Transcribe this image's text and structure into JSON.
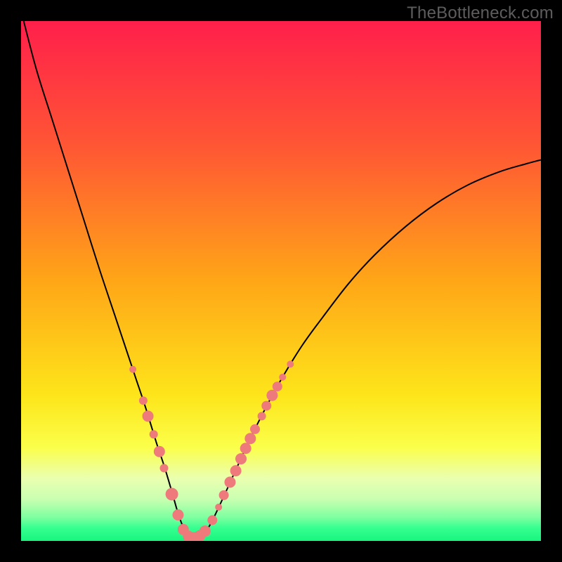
{
  "watermark": "TheBottleneck.com",
  "chart_data": {
    "type": "line",
    "title": "",
    "xlabel": "",
    "ylabel": "",
    "xlim": [
      0,
      100
    ],
    "ylim": [
      0,
      100
    ],
    "grid": false,
    "legend": false,
    "axes_visible": false,
    "background": {
      "type": "vertical-gradient",
      "stops": [
        {
          "pos": 0.0,
          "color": "#ff1f4b"
        },
        {
          "pos": 0.24,
          "color": "#ff5634"
        },
        {
          "pos": 0.5,
          "color": "#ffa617"
        },
        {
          "pos": 0.72,
          "color": "#fde51a"
        },
        {
          "pos": 0.82,
          "color": "#fbff4a"
        },
        {
          "pos": 0.88,
          "color": "#eaffb0"
        },
        {
          "pos": 0.92,
          "color": "#c9ffb1"
        },
        {
          "pos": 0.955,
          "color": "#7dffa0"
        },
        {
          "pos": 0.975,
          "color": "#36ff90"
        },
        {
          "pos": 1.0,
          "color": "#18f57f"
        }
      ]
    },
    "series": [
      {
        "name": "bottleneck-curve",
        "color": "#000000",
        "x": [
          0.5,
          3,
          6,
          9,
          12,
          15,
          18,
          20,
          22,
          24,
          26,
          27.5,
          29,
          30.3,
          31.5,
          32.7,
          34,
          36,
          38.5,
          41,
          44,
          47,
          50,
          54,
          58,
          63,
          68,
          74,
          80,
          86,
          92,
          97,
          100
        ],
        "y": [
          100,
          90.5,
          81,
          71.5,
          62,
          52.5,
          43.5,
          37.5,
          31.5,
          25.5,
          19,
          14.5,
          9.5,
          5,
          2,
          0.5,
          0.5,
          2.5,
          7.5,
          13,
          19.5,
          25.5,
          31,
          37.5,
          43,
          49.5,
          55,
          60.5,
          65,
          68.5,
          71,
          72.5,
          73.3
        ]
      }
    ],
    "markers": {
      "color": "#ee7a7c",
      "radius_range": [
        4,
        10
      ],
      "points": [
        {
          "x": 21.5,
          "y": 33.0,
          "r": 5
        },
        {
          "x": 23.5,
          "y": 27.0,
          "r": 6
        },
        {
          "x": 24.4,
          "y": 24.0,
          "r": 8
        },
        {
          "x": 25.5,
          "y": 20.5,
          "r": 6
        },
        {
          "x": 26.6,
          "y": 17.2,
          "r": 8
        },
        {
          "x": 27.5,
          "y": 14.0,
          "r": 6
        },
        {
          "x": 29.0,
          "y": 9.0,
          "r": 9
        },
        {
          "x": 30.2,
          "y": 5.0,
          "r": 8
        },
        {
          "x": 31.2,
          "y": 2.2,
          "r": 8
        },
        {
          "x": 32.2,
          "y": 0.9,
          "r": 8
        },
        {
          "x": 33.3,
          "y": 0.6,
          "r": 8
        },
        {
          "x": 34.4,
          "y": 1.0,
          "r": 8
        },
        {
          "x": 35.4,
          "y": 1.9,
          "r": 8
        },
        {
          "x": 36.8,
          "y": 4.0,
          "r": 7
        },
        {
          "x": 38.0,
          "y": 6.5,
          "r": 5
        },
        {
          "x": 39.0,
          "y": 8.8,
          "r": 7
        },
        {
          "x": 40.2,
          "y": 11.3,
          "r": 8
        },
        {
          "x": 41.3,
          "y": 13.5,
          "r": 8
        },
        {
          "x": 42.3,
          "y": 15.8,
          "r": 8
        },
        {
          "x": 43.2,
          "y": 17.8,
          "r": 8
        },
        {
          "x": 44.1,
          "y": 19.7,
          "r": 8
        },
        {
          "x": 45.0,
          "y": 21.5,
          "r": 7
        },
        {
          "x": 46.3,
          "y": 24.0,
          "r": 6
        },
        {
          "x": 47.2,
          "y": 26.0,
          "r": 7
        },
        {
          "x": 48.3,
          "y": 28.0,
          "r": 8
        },
        {
          "x": 49.3,
          "y": 29.7,
          "r": 7
        },
        {
          "x": 50.3,
          "y": 31.5,
          "r": 5
        },
        {
          "x": 51.8,
          "y": 34.0,
          "r": 5
        }
      ]
    }
  }
}
